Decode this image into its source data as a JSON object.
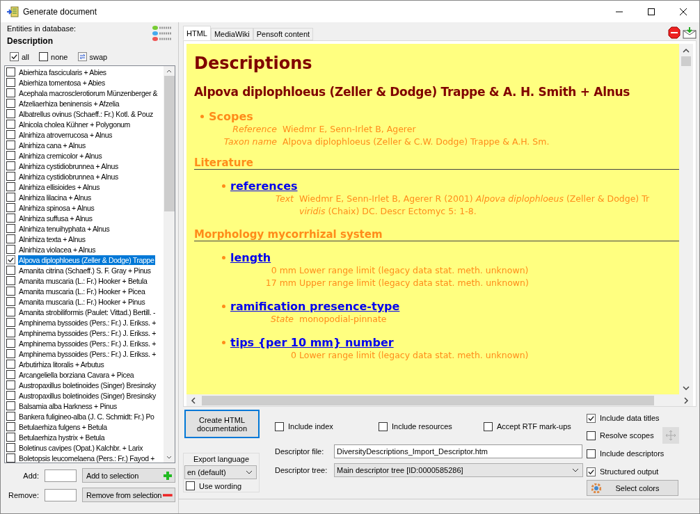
{
  "window": {
    "title": "Generate document"
  },
  "left": {
    "entities_label": "Entities in database:",
    "entity_type": "Description",
    "select_controls": [
      {
        "kind": "check",
        "label": "all",
        "checked": true
      },
      {
        "kind": "check",
        "label": "none",
        "checked": false
      },
      {
        "kind": "swap",
        "label": "swap"
      }
    ],
    "items": [
      {
        "label": "Abierhiza fascicularis + Abies",
        "checked": false,
        "selected": false
      },
      {
        "label": "Abierhiza tomentosa + Abies",
        "checked": false,
        "selected": false
      },
      {
        "label": "Acephala macrosclerotiorum Münzenberger &",
        "checked": false,
        "selected": false
      },
      {
        "label": "Afzeliaerhiza beninensis + Afzelia",
        "checked": false,
        "selected": false
      },
      {
        "label": "Albatrellus ovinus (Schaeff.: Fr.) Kotl. & Pouz",
        "checked": false,
        "selected": false
      },
      {
        "label": "Alnicola cholea Kühner + Polygonum",
        "checked": false,
        "selected": false
      },
      {
        "label": "Alnirhiza atroverrucosa + Alnus",
        "checked": false,
        "selected": false
      },
      {
        "label": "Alnirhiza cana + Alnus",
        "checked": false,
        "selected": false
      },
      {
        "label": "Alnirhiza cremicolor + Alnus",
        "checked": false,
        "selected": false
      },
      {
        "label": "Alnirhiza cystidiobrunnea + Alnus",
        "checked": false,
        "selected": false
      },
      {
        "label": "Alnirhiza cystidiobrunnea + Alnus",
        "checked": false,
        "selected": false
      },
      {
        "label": "Alnirhiza ellisioides + Alnus",
        "checked": false,
        "selected": false
      },
      {
        "label": "Alnirhiza lilacina + Alnus",
        "checked": false,
        "selected": false
      },
      {
        "label": "Alnirhiza spinosa + Alnus",
        "checked": false,
        "selected": false
      },
      {
        "label": "Alnirhiza suffusa + Alnus",
        "checked": false,
        "selected": false
      },
      {
        "label": "Alnirhiza tenuihyphata + Alnus",
        "checked": false,
        "selected": false
      },
      {
        "label": "Alnirhiza texta + Alnus",
        "checked": false,
        "selected": false
      },
      {
        "label": "Alnirhiza violacea + Alnus",
        "checked": false,
        "selected": false
      },
      {
        "label": "Alpova diplophloeus (Zeller & Dodge) Trappe",
        "checked": true,
        "selected": true
      },
      {
        "label": "Amanita citrina (Schaeff.) S. F. Gray + Pinus",
        "checked": false,
        "selected": false
      },
      {
        "label": "Amanita muscaria (L.: Fr.) Hooker + Betula",
        "checked": false,
        "selected": false
      },
      {
        "label": "Amanita muscaria (L.: Fr.) Hooker + Picea",
        "checked": false,
        "selected": false
      },
      {
        "label": "Amanita muscaria (L.: Fr.) Hooker + Pinus",
        "checked": false,
        "selected": false
      },
      {
        "label": "Amanita strobiliformis (Paulet: Vittad.) Bertill. -",
        "checked": false,
        "selected": false
      },
      {
        "label": "Amphinema byssoides (Pers.: Fr.) J. Erikss. +",
        "checked": false,
        "selected": false
      },
      {
        "label": "Amphinema byssoides (Pers.: Fr.) J. Erikss. +",
        "checked": false,
        "selected": false
      },
      {
        "label": "Amphinema byssoides (Pers.: Fr.) J. Erikss. +",
        "checked": false,
        "selected": false
      },
      {
        "label": "Amphinema byssoides (Pers.: Fr.) J. Erikss. +",
        "checked": false,
        "selected": false
      },
      {
        "label": "Arbutirhiza litoralis + Arbutus",
        "checked": false,
        "selected": false
      },
      {
        "label": "Arcangeliella borziana Cavara + Picea",
        "checked": false,
        "selected": false
      },
      {
        "label": "Austropaxillus boletinoides (Singer) Bresinsky",
        "checked": false,
        "selected": false
      },
      {
        "label": "Austropaxillus boletinoides (Singer) Bresinsky",
        "checked": false,
        "selected": false
      },
      {
        "label": "Balsamia alba Harkness + Pinus",
        "checked": false,
        "selected": false
      },
      {
        "label": "Bankera fuligineo-alba (J. C. Schmidt: Fr.) Po",
        "checked": false,
        "selected": false
      },
      {
        "label": "Betulaerhiza fulgens + Betula",
        "checked": false,
        "selected": false
      },
      {
        "label": "Betulaerhiza hystrix + Betula",
        "checked": false,
        "selected": false
      },
      {
        "label": "Boletinus cavipes (Opat.) Kalchbr. + Larix",
        "checked": false,
        "selected": false
      },
      {
        "label": "Boletopsis leucomelaena (Pers.: Fr.) Fayod +",
        "checked": false,
        "selected": false
      }
    ],
    "add_label": "Add:",
    "add_button": "Add to selection",
    "remove_label": "Remove:",
    "remove_button": "Remove from selection"
  },
  "tabs": [
    {
      "label": "HTML",
      "selected": true
    },
    {
      "label": "MediaWiki",
      "selected": false
    },
    {
      "label": "Pensoft content",
      "selected": false
    }
  ],
  "document": [
    {
      "kind": "title",
      "text": "Descriptions"
    },
    {
      "kind": "entity",
      "text": "Alpova diplophloeus (Zeller & Dodge) Trappe & A. H. Smith + Alnus"
    },
    {
      "kind": "group",
      "text": "Scopes",
      "fields": [
        {
          "label": "Reference",
          "value": "Wiedmr E, Senn-Irlet B, Agerer"
        },
        {
          "label": "Taxon name",
          "value": "Alpova diplophloeus (Zeller & C.W. Dodge) Trappe & A.H. Sm."
        }
      ]
    },
    {
      "kind": "section",
      "text": "Literature"
    },
    {
      "kind": "character",
      "text": "references",
      "fields": [
        {
          "label": "Text",
          "lines": [
            "Wiedmr E, Senn-Irlet B, Agerer R (2001) *Alpova diplophloeus* (Zeller & Dodge) Tr",
            "*viridis* (Chaix) DC. Descr Ectomyc 5: 1-8."
          ]
        }
      ]
    },
    {
      "kind": "section",
      "text": "Morphology mycorrhizal system"
    },
    {
      "kind": "character",
      "text": "length",
      "fields": [
        {
          "kind": "measure",
          "label": "0 mm",
          "value": "Lower range limit (legacy data stat. meth. unknown)"
        },
        {
          "kind": "measure",
          "label": "17 mm",
          "value": "Upper range limit (legacy data stat. meth. unknown)"
        }
      ]
    },
    {
      "kind": "character",
      "text": "ramification presence-type",
      "fields": [
        {
          "label": "State",
          "value": "monopodial-pinnate"
        }
      ]
    },
    {
      "kind": "character",
      "text": "tips {per 10 mm} number",
      "fields": [
        {
          "kind": "measure",
          "label": "0",
          "value": "Lower range limit (legacy data stat. meth. unknown)"
        }
      ]
    }
  ],
  "create_button": "Create HTML documentation",
  "top_options": [
    {
      "label": "Include index",
      "checked": false
    },
    {
      "label": "Include resources",
      "checked": false
    },
    {
      "label": "Accept RTF mark-ups",
      "checked": false
    }
  ],
  "side_options": [
    {
      "label": "Include data titles",
      "checked": true
    },
    {
      "label": "Resolve scopes",
      "checked": false
    },
    {
      "label": "Include descriptors",
      "checked": false
    },
    {
      "label": "Structured output",
      "checked": true
    }
  ],
  "export_language": {
    "title": "Export language",
    "value": "en (default)",
    "use_wording": {
      "label": "Use wording",
      "checked": false
    }
  },
  "descriptor_file": {
    "label": "Descriptor file:",
    "value": "DiversityDescriptions_Import_Descriptor.htm"
  },
  "descriptor_tree": {
    "label": "Descriptor tree:",
    "value": "Main descriptor tree [ID:0000585286]"
  },
  "select_colors_button": "Select colors"
}
